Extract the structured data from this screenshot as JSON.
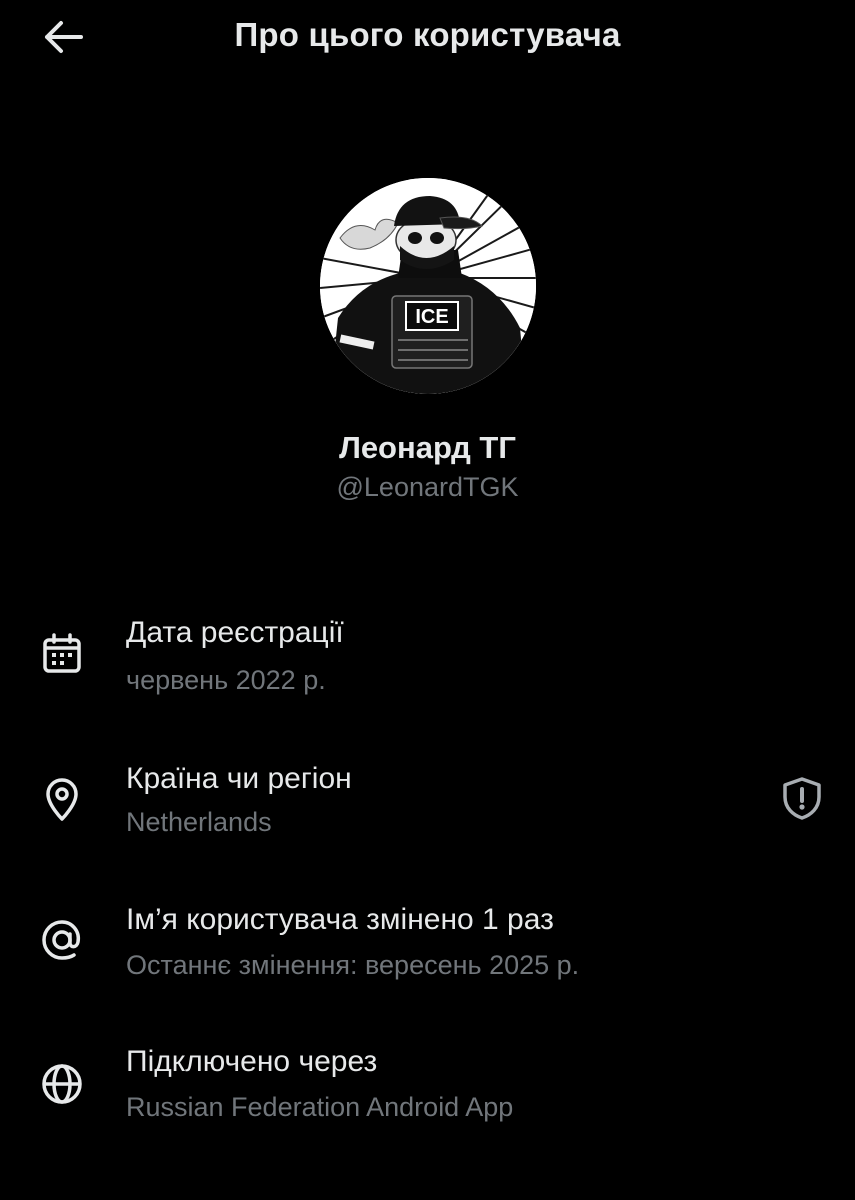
{
  "header": {
    "title": "Про цього користувача",
    "back_icon": "arrow-left-icon"
  },
  "profile": {
    "display_name": "Леонард ТГ",
    "handle": "@LeonardTGK",
    "avatar_badge_text": "ICE"
  },
  "details": [
    {
      "icon": "calendar-icon",
      "title": "Дата реєстрації",
      "subtitle": "червень 2022 р."
    },
    {
      "icon": "location-pin-icon",
      "title": "Країна чи регіон",
      "subtitle": "Netherlands",
      "trailing_icon": "shield-alert-icon"
    },
    {
      "icon": "at-sign-icon",
      "title": "Ім’я користувача змінено 1 раз",
      "subtitle": "Останнє змінення: вересень 2025 р."
    },
    {
      "icon": "globe-icon",
      "title": "Підключено через",
      "subtitle": "Russian Federation Android App"
    }
  ],
  "colors": {
    "background": "#000000",
    "primary_text": "#e7e9ea",
    "secondary_text": "#71767b",
    "icon": "#e7e9ea"
  }
}
